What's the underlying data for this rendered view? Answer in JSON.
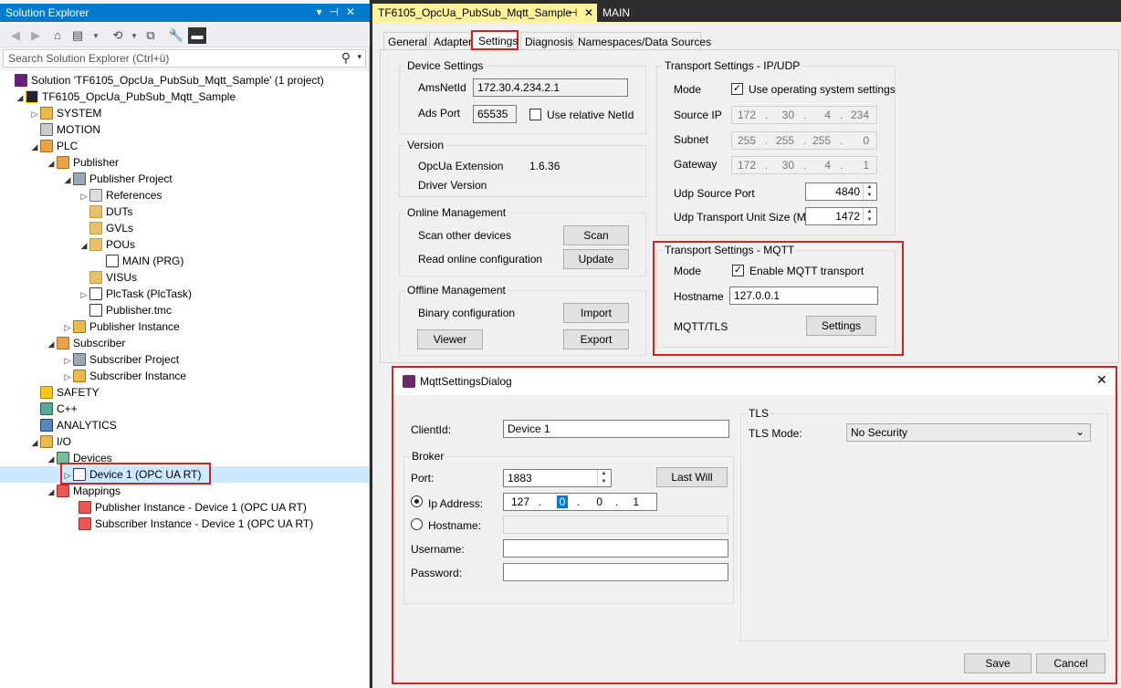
{
  "solution_explorer": {
    "title": "Solution Explorer",
    "search_placeholder": "Search Solution Explorer (Ctrl+ü)",
    "tree": [
      {
        "label": "Solution 'TF6105_OpcUa_PubSub_Mqtt_Sample' (1 project)"
      },
      {
        "label": "TF6105_OpcUa_PubSub_Mqtt_Sample"
      },
      {
        "label": "SYSTEM"
      },
      {
        "label": "MOTION"
      },
      {
        "label": "PLC"
      },
      {
        "label": "Publisher"
      },
      {
        "label": "Publisher Project"
      },
      {
        "label": "References"
      },
      {
        "label": "DUTs"
      },
      {
        "label": "GVLs"
      },
      {
        "label": "POUs"
      },
      {
        "label": "MAIN (PRG)"
      },
      {
        "label": "VISUs"
      },
      {
        "label": "PlcTask (PlcTask)"
      },
      {
        "label": "Publisher.tmc"
      },
      {
        "label": "Publisher Instance"
      },
      {
        "label": "Subscriber"
      },
      {
        "label": "Subscriber Project"
      },
      {
        "label": "Subscriber Instance"
      },
      {
        "label": "SAFETY"
      },
      {
        "label": "C++"
      },
      {
        "label": "ANALYTICS"
      },
      {
        "label": "I/O"
      },
      {
        "label": "Devices"
      },
      {
        "label": "Device 1 (OPC UA RT)"
      },
      {
        "label": "Mappings"
      },
      {
        "label": "Publisher Instance - Device 1 (OPC UA RT)"
      },
      {
        "label": "Subscriber Instance - Device 1 (OPC UA RT)"
      }
    ]
  },
  "doc_tabs": {
    "active": "TF6105_OpcUa_PubSub_Mqtt_Sample",
    "pin": "⊣",
    "close": "✕",
    "other": "MAIN"
  },
  "sub_tabs": [
    "General",
    "Adapter",
    "Settings",
    "Diagnosis",
    "Namespaces/Data Sources"
  ],
  "device_settings": {
    "title": "Device Settings",
    "amsnetid_label": "AmsNetId",
    "amsnetid": "172.30.4.234.2.1",
    "adsport_label": "Ads Port",
    "adsport": "65535",
    "relative_label": "Use relative NetId"
  },
  "version": {
    "title": "Version",
    "ext_label": "OpcUa Extension",
    "ext_value": "1.6.36",
    "driver_label": "Driver Version"
  },
  "online": {
    "title": "Online Management",
    "scan_label": "Scan other devices",
    "scan_btn": "Scan",
    "read_label": "Read online configuration",
    "update_btn": "Update"
  },
  "offline": {
    "title": "Offline Management",
    "binary_label": "Binary configuration",
    "import_btn": "Import",
    "viewer_btn": "Viewer",
    "export_btn": "Export"
  },
  "ipudp": {
    "title": "Transport Settings - IP/UDP",
    "mode_label": "Mode",
    "mode_check": "Use operating system settings",
    "srcip_label": "Source IP",
    "srcip": [
      "172",
      "30",
      "4",
      "234"
    ],
    "subnet_label": "Subnet",
    "subnet": [
      "255",
      "255",
      "255",
      "0"
    ],
    "gateway_label": "Gateway",
    "gateway": [
      "172",
      "30",
      "4",
      "1"
    ],
    "udpport_label": "Udp Source Port",
    "udpport": "4840",
    "mtu_label": "Udp Transport Unit Size (Mtu)",
    "mtu": "1472"
  },
  "mqtt": {
    "title": "Transport Settings - MQTT",
    "mode_label": "Mode",
    "mode_check": "Enable MQTT transport",
    "host_label": "Hostname",
    "host": "127.0.0.1",
    "tls_label": "MQTT/TLS",
    "settings_btn": "Settings"
  },
  "dialog": {
    "title": "MqttSettingsDialog",
    "close": "✕",
    "clientid_label": "ClientId:",
    "clientid": "Device 1",
    "broker_title": "Broker",
    "port_label": "Port:",
    "port": "1883",
    "lastwill_btn": "Last Will",
    "ip_label": "Ip Address:",
    "ip": [
      "127",
      "0",
      "0",
      "1"
    ],
    "hostname_label": "Hostname:",
    "username_label": "Username:",
    "password_label": "Password:",
    "tls_title": "TLS",
    "tlsmode_label": "TLS Mode:",
    "tlsmode": "No Security",
    "save_btn": "Save",
    "cancel_btn": "Cancel"
  },
  "colors": {
    "accent": "#007acc",
    "highlight": "#e01e1e"
  }
}
